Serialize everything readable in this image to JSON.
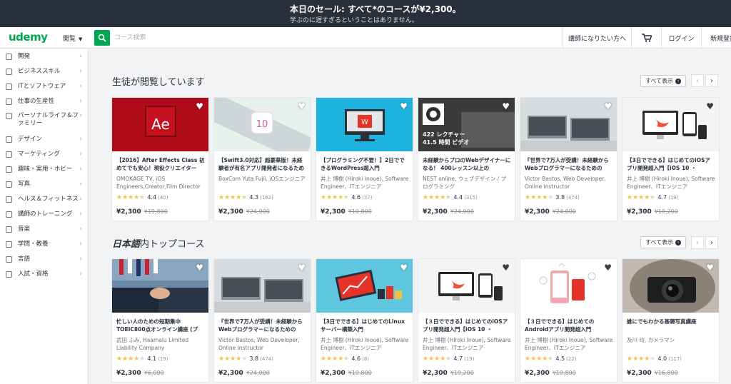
{
  "banner": {
    "headline": "本日のセール: すべて*のコースが¥2,300。",
    "sub": "学ぶのに遅すぎるということはありません。"
  },
  "header": {
    "logo": "udemy",
    "browse": "閲覧",
    "search_placeholder": "コース検索",
    "become_instructor": "講師になりたい方へ",
    "login": "ログイン",
    "signup": "新規登録"
  },
  "sidebar": {
    "items": [
      {
        "label": "開発",
        "icon": "code-icon"
      },
      {
        "label": "ビジネススキル",
        "icon": "chart-icon"
      },
      {
        "label": "ITとソフトウェア",
        "icon": "laptop-icon"
      },
      {
        "label": "仕事の生産性",
        "icon": "calendar-icon"
      },
      {
        "label": "パーソナルライフ＆ファミリー",
        "icon": "person-icon"
      },
      {
        "label": "デザイン",
        "icon": "design-icon"
      },
      {
        "label": "マーケティング",
        "icon": "megaphone-icon"
      },
      {
        "label": "趣味・実用・ホビー",
        "icon": "hobby-icon"
      },
      {
        "label": "写真",
        "icon": "camera-icon"
      },
      {
        "label": "ヘルス＆フィットネス",
        "icon": "health-icon"
      },
      {
        "label": "講師のトレーニング",
        "icon": "trainer-icon"
      },
      {
        "label": "音楽",
        "icon": "music-icon"
      },
      {
        "label": "学問・教養",
        "icon": "gear-icon"
      },
      {
        "label": "言語",
        "icon": "globe-icon"
      },
      {
        "label": "入試・資格",
        "icon": "document-icon"
      }
    ]
  },
  "sections": [
    {
      "title": "生徒が閲覧しています",
      "show_all": "すべて表示",
      "courses": [
        {
          "title": "【2016】After Effects Class 初めてでも安心！現役クリエイター",
          "instructor": "OMOKAGE TV, iOS Engineers,Creator,Film Director",
          "rating": "4.4",
          "count": "(40)",
          "stars": 4.4,
          "price": "¥2,300",
          "orig": "¥19,800",
          "thumb": "ae-thumb"
        },
        {
          "title": "【Swift3.0対応】超豪華版！未経験者が有名アプリ開発者になるための",
          "instructor": "BoxCom Yuta Fujii, iOSエンジニア",
          "rating": "4.3",
          "count": "(162)",
          "stars": 4.3,
          "price": "¥2,300",
          "orig": "¥24,000",
          "thumb": "ios10-thumb"
        },
        {
          "title": "【プログラミング不要！】2日でできるWordPress超入門",
          "instructor": "井上 博樹 (Hiroki Inoue), Software Engineer、ITエンジニア",
          "rating": "4.6",
          "count": "(37)",
          "stars": 4.6,
          "price": "¥2,300",
          "orig": "¥10,800",
          "thumb": "wordpress-thumb"
        },
        {
          "title": "未経験からプロのWebデザイナーになる！ 400レッスン以上の",
          "instructor": "NEST online, ウェブデザイン / プログラミング",
          "rating": "4.4",
          "count": "(315)",
          "stars": 4.4,
          "price": "¥2,300",
          "orig": "¥24,000",
          "thumb": "webdesign-thumb",
          "overlay1": "422 レクチャー",
          "overlay2": "41.5 時間 ビデオ"
        },
        {
          "title": "『世界で7万人が受講！未経験からWebプログラマーになるための",
          "instructor": "Victor Bastos, Web Developer, Online Instructor",
          "rating": "3.8",
          "count": "(474)",
          "stars": 3.8,
          "price": "¥2,300",
          "orig": "¥24,000",
          "thumb": "laptops-thumb"
        },
        {
          "title": "【3日でできる】はじめてのiOSアプリ開発超入門【iOS 10 ・",
          "instructor": "井上 博樹 (Hiroki Inoue), Software Engineer、ITエンジニア",
          "rating": "4.7",
          "count": "(19)",
          "stars": 4.7,
          "price": "¥2,300",
          "orig": "¥10,200",
          "thumb": "swift-devices-thumb"
        }
      ]
    },
    {
      "title_bold": "日本語",
      "title_rest": "内トップコース",
      "show_all": "すべて表示",
      "courses": [
        {
          "title": "忙しい人のための短期集中TOEIC800点オンライン講座 (プ",
          "instructor": "武田 ふみ, Haamalu Limited Liability Company",
          "rating": "4.1",
          "count": "(19)",
          "stars": 4.1,
          "price": "¥2,300",
          "orig": "¥6,000",
          "thumb": "handshake-thumb"
        },
        {
          "title": "『世界で7万人が受講！未経験からWebプログラマーになるための",
          "instructor": "Victor Bastos, Web Developer, Online Instructor",
          "rating": "3.8",
          "count": "(474)",
          "stars": 3.8,
          "price": "¥2,300",
          "orig": "¥24,000",
          "thumb": "laptops-thumb"
        },
        {
          "title": "【3日でできる】はじめてのLinuxサーバー構築入門",
          "instructor": "井上 博樹 (Hiroki Inoue), Software Engineer、ITエンジニア",
          "rating": "4.6",
          "count": "(8)",
          "stars": 4.6,
          "price": "¥2,300",
          "orig": "¥10,800",
          "thumb": "linux-thumb"
        },
        {
          "title": "【３日でできる】はじめてのiOSアプリ開発超入門【iOS 10 ・",
          "instructor": "井上 博樹 (Hiroki Inoue), Software Engineer、ITエンジニア",
          "rating": "4.7",
          "count": "(19)",
          "stars": 4.7,
          "price": "¥2,300",
          "orig": "¥10,200",
          "thumb": "swift-devices-thumb"
        },
        {
          "title": "【３日でできる】はじめてのAndroidアプリ開発超入門",
          "instructor": "井上 博樹 (Hiroki Inoue), Software Engineer、ITエンジニア",
          "rating": "4.5",
          "count": "(22)",
          "stars": 4.5,
          "price": "¥2,300",
          "orig": "¥10,800",
          "thumb": "android-thumb"
        },
        {
          "title": "誰にでもわかる基礎写真講座",
          "instructor": "及川 均, カメラマン",
          "rating": "4.0",
          "count": "(117)",
          "stars": 4.0,
          "price": "¥2,300",
          "orig": "¥16,800",
          "thumb": "camera-thumb"
        }
      ]
    }
  ],
  "colors": {
    "brand": "#00a651",
    "banner": "#29303b",
    "star": "#f4c150"
  }
}
